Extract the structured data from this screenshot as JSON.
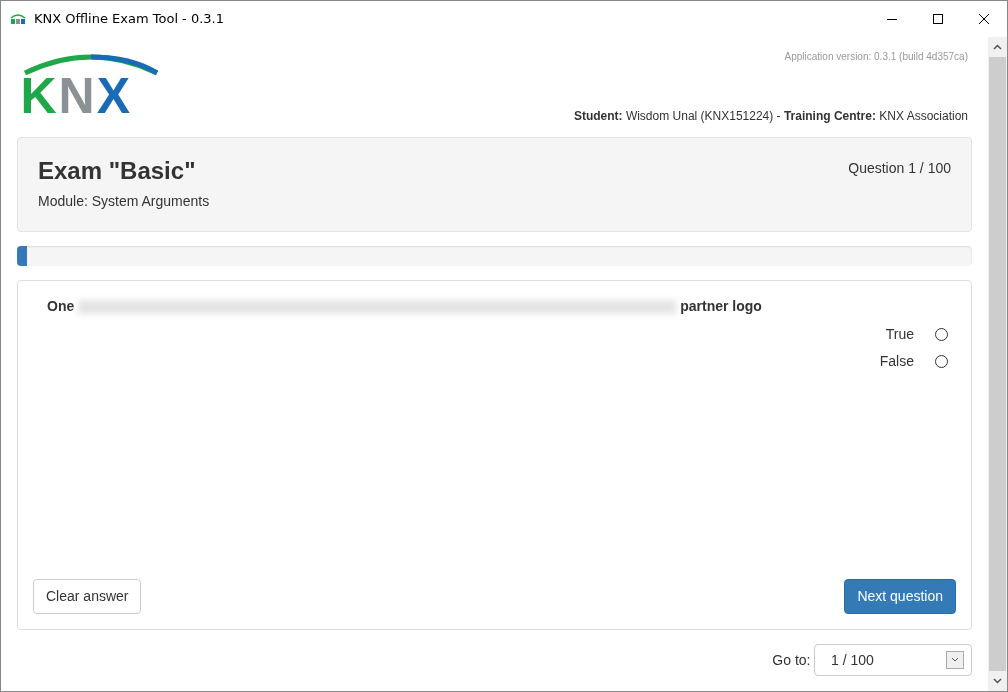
{
  "window": {
    "title": "KNX Offline Exam Tool - 0.3.1"
  },
  "logo": {
    "letters": [
      {
        "text": "K",
        "color": "#1fa84a"
      },
      {
        "text": "N",
        "color": "#8c9196"
      },
      {
        "text": "X",
        "color": "#1a6bb5"
      }
    ]
  },
  "app_version": "Application version: 0.3.1 (build 4d357ca)",
  "student_line": "**Student:** Wisdom Unal (KNX151224) - **Training Centre:** KNX Association",
  "exam": {
    "title": "Exam \"Basic\"",
    "module": "Module: System Arguments",
    "counter": "Question 1 / 100"
  },
  "progress": {
    "level": 0.01
  },
  "question": {
    "text_start": "One",
    "text_end": "partner logo",
    "blurred": true,
    "options": [
      {
        "label": "True",
        "selected": false
      },
      {
        "label": "False",
        "selected": false
      }
    ]
  },
  "buttons": {
    "clear": "Clear answer",
    "next": "Next question"
  },
  "goto": {
    "label": "Go to:",
    "value": "1 / 100"
  }
}
